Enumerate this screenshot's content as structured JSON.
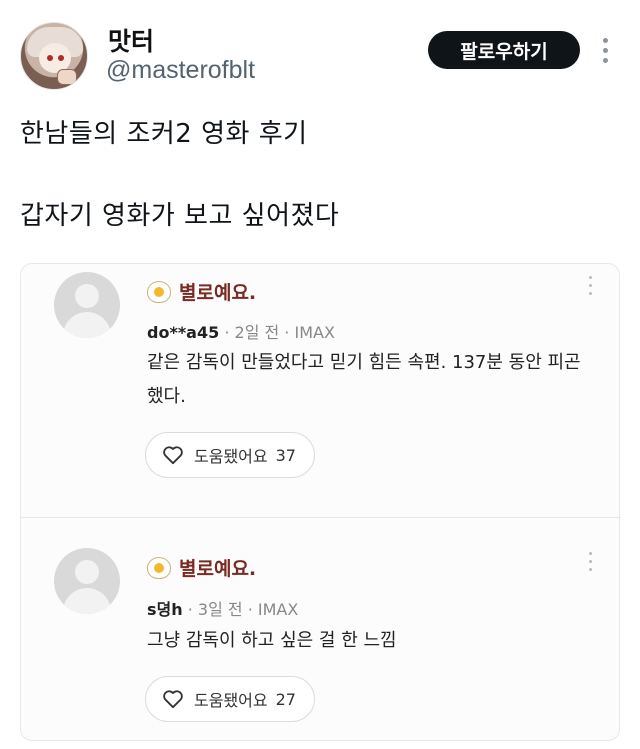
{
  "post": {
    "author": {
      "display_name": "맛터",
      "handle": "@masterofblt"
    },
    "follow_label": "팔로우하기",
    "lines": [
      "한남들의 조커2 영화 후기",
      "갑자기 영화가 보고 싶어졌다"
    ]
  },
  "reviews": [
    {
      "rating_label": "별로예요.",
      "user": "do**a45",
      "meta": " · 2일 전 · IMAX",
      "comment": "같은 감독이 만들었다고 믿기 힘든 속편. 137분 동안 피곤했다.",
      "helpful_label": "도움됐어요",
      "helpful_count": "37"
    },
    {
      "rating_label": "별로예요.",
      "user": "s뎡h",
      "meta": " · 3일 전 · IMAX",
      "comment": "그냥 감독이 하고 싶은 걸 한 느낌",
      "helpful_label": "도움됐어요",
      "helpful_count": "27"
    }
  ],
  "icons": {
    "more": "more-vertical-icon",
    "rating": "fried-egg-icon",
    "helpful": "heart-outline-icon"
  },
  "colors": {
    "follow_button": "#0f1419",
    "rating_label": "#7a2a22",
    "handle": "#536471"
  }
}
